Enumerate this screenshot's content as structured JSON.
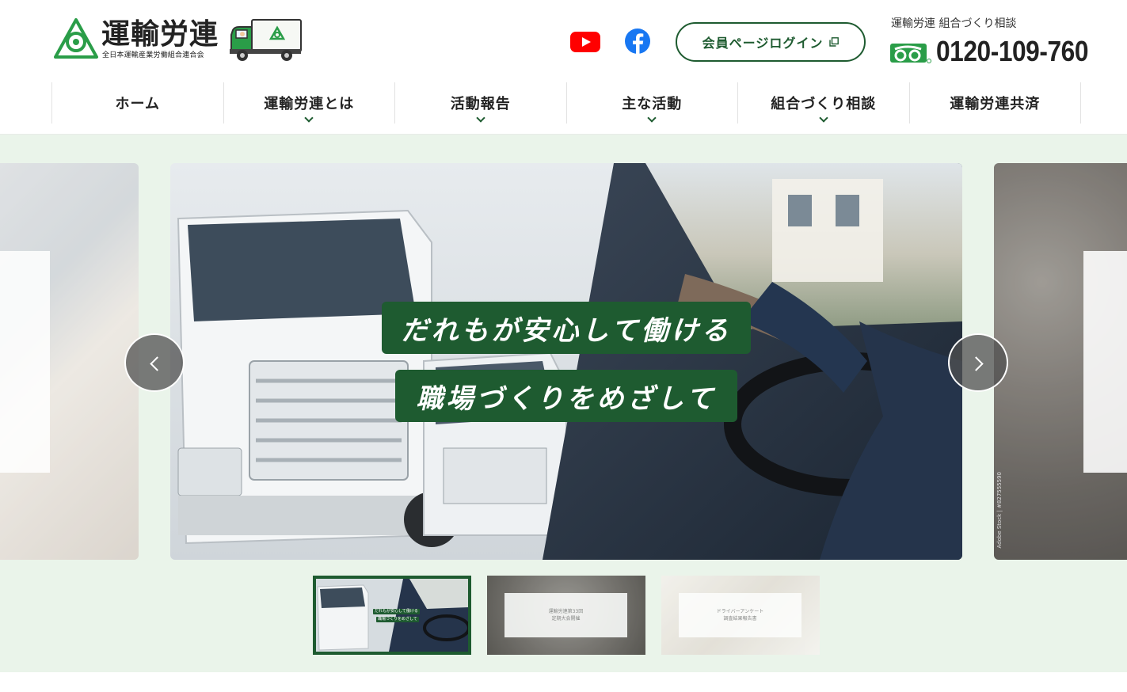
{
  "header": {
    "logo_title": "運輸労連",
    "logo_subtitle": "全日本運輸産業労働組合連合会",
    "login_label": "会員ページログイン",
    "consult_label": "運輸労連 組合づくり相談",
    "phone": "0120-109-760"
  },
  "nav": {
    "items": [
      {
        "label": "ホーム",
        "has_dropdown": false
      },
      {
        "label": "運輸労連とは",
        "has_dropdown": true
      },
      {
        "label": "活動報告",
        "has_dropdown": true
      },
      {
        "label": "主な活動",
        "has_dropdown": true
      },
      {
        "label": "組合づくり相談",
        "has_dropdown": true
      },
      {
        "label": "運輸労連共済",
        "has_dropdown": false
      }
    ]
  },
  "hero": {
    "caption_line1": "だれもが安心して働ける",
    "caption_line2": "職場づくりをめざして",
    "side_credit": "Adobe Stock | #827555590",
    "thumbnails": [
      {
        "line1": "だれもが安心して働ける",
        "line2": "職場づくりをめざして"
      },
      {
        "line1": "運輸労連第33回",
        "line2": "定期大会開催"
      },
      {
        "line1": "ドライバーアンケート",
        "line2": "調査結果報告書"
      }
    ],
    "active_slide": 1
  },
  "colors": {
    "brand_green": "#1e5b30",
    "hero_bg": "#eaf4ea",
    "logo_green": "#2a9d48",
    "youtube_red": "#ff0000",
    "facebook_blue": "#1877f2"
  },
  "icons": {
    "youtube": "youtube-icon",
    "facebook": "facebook-icon",
    "external": "external-link-icon",
    "freedial": "freedial-icon"
  }
}
